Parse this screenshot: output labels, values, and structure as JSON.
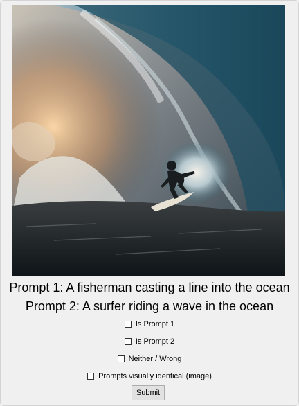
{
  "image": {
    "subject": "surfer riding a barreling ocean wave"
  },
  "prompts": {
    "prompt1": "Prompt 1: A fisherman casting a line into the ocean",
    "prompt2": "Prompt 2: A surfer riding a wave in the ocean"
  },
  "options": [
    {
      "label": "Is Prompt 1",
      "checked": false
    },
    {
      "label": "Is Prompt 2",
      "checked": false
    },
    {
      "label": "Neither / Wrong",
      "checked": false
    },
    {
      "label": "Prompts visually identical (image)",
      "checked": false
    }
  ],
  "submit_label": "Submit"
}
